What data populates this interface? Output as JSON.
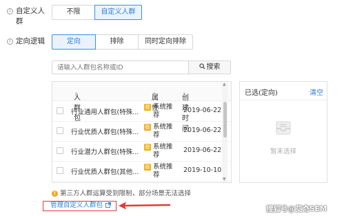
{
  "form": {
    "audience_label_line1": "自定义人",
    "audience_label_line2": "群",
    "audience_options": [
      "不限",
      "自定义人群"
    ],
    "logic_label": "定向逻辑",
    "logic_options": [
      "定向",
      "排除",
      "同时定向排除"
    ],
    "info_icon": "info-icon"
  },
  "search": {
    "placeholder": "请输入人群包名称或ID",
    "button_label": "搜索",
    "button_icon": "search-icon"
  },
  "table": {
    "headers": [
      "人群包",
      "属性",
      "创建时间"
    ],
    "rows": [
      {
        "name": "行业通用人群包(特殊...",
        "attr_line1": "系统推",
        "attr_line2": "荐",
        "date": "2019-06-22"
      },
      {
        "name": "行业优质人群包(特殊...",
        "attr_line1": "系统推",
        "attr_line2": "荐",
        "date": "2019-06-22"
      },
      {
        "name": "行业潜力人群包(特殊...",
        "attr_line1": "系统推",
        "attr_line2": "荐",
        "date": "2019-06-22"
      },
      {
        "name": "行业优质人群包(其他...",
        "attr_line1": "系统推",
        "attr_line2": "荐",
        "date": "2019-10-10"
      }
    ],
    "tag_icon_text": "荐"
  },
  "selected": {
    "title": "已选(定向)",
    "clear_label": "清空",
    "empty_text": "暂未选择",
    "empty_icon": "inbox-icon"
  },
  "notice": {
    "text": "第三方人群运算受到限制，部分场景无法选择",
    "icon": "warning-icon"
  },
  "manage": {
    "link_label": "管理自定义人群包",
    "link_icon": "external-link-icon"
  },
  "watermark": "搜狐号@艾奇SEM",
  "colors": {
    "accent": "#2f7fd6",
    "active_bg": "#eaf3fd",
    "highlight_red": "#e03a3a",
    "tag_orange": "#f2b21d"
  }
}
